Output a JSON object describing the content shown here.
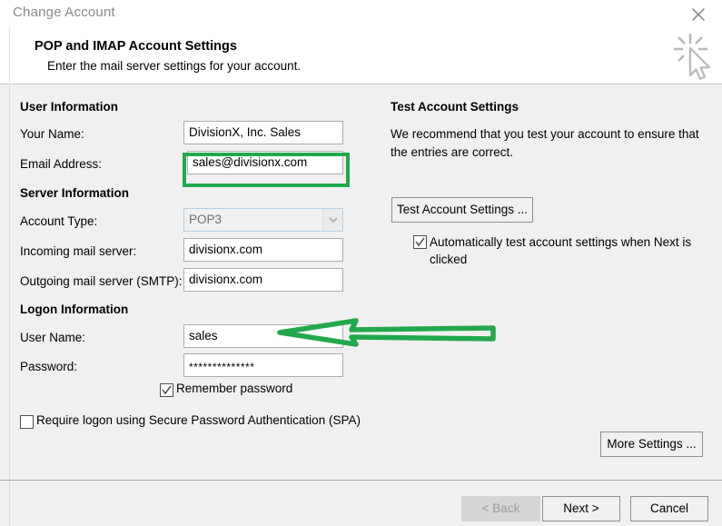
{
  "window": {
    "title": "Change Account",
    "close_icon": "close-icon"
  },
  "header": {
    "title": "POP and IMAP Account Settings",
    "subtitle": "Enter the mail server settings for your account.",
    "graphic_icon": "cursor-click-sparkle-icon"
  },
  "user_information": {
    "group_label": "User Information",
    "fields": [
      {
        "label": "Your Name:",
        "value": "DivisionX, Inc. Sales"
      },
      {
        "label": "Email Address:",
        "value": "sales@divisionx.com"
      }
    ]
  },
  "server_information": {
    "group_label": "Server Information",
    "account_type": {
      "label": "Account Type:",
      "value": "POP3",
      "disabled": true,
      "arrow_icon": "chevron-down-icon"
    },
    "fields": [
      {
        "label": "Incoming mail server:",
        "value": "divisionx.com"
      },
      {
        "label": "Outgoing mail server (SMTP):",
        "value": "divisionx.com"
      }
    ]
  },
  "logon_information": {
    "group_label": "Logon Information",
    "fields": [
      {
        "label": "User Name:",
        "value": "sales"
      },
      {
        "label": "Password:",
        "value": "**************"
      }
    ],
    "remember_password": {
      "label": "Remember password",
      "checked": true
    },
    "require_spa": {
      "label": "Require logon using Secure Password Authentication (SPA)",
      "checked": false
    }
  },
  "test_account": {
    "group_label": "Test Account Settings",
    "description": "We recommend that you test your account to ensure that the entries are correct.",
    "test_button": "Test Account Settings ...",
    "auto_test": {
      "label": "Automatically test account settings when Next is clicked",
      "checked": true
    }
  },
  "more_settings_button": "More Settings ...",
  "footer": {
    "back_button": "< Back",
    "next_button": "Next >",
    "cancel_button": "Cancel"
  },
  "colors": {
    "annotation_green": "#22a84a",
    "dialog_background": "#f0f0f0",
    "header_background": "#ffffff",
    "title_text": "#8a8a8a"
  },
  "annotations": {
    "email_highlight": "green-rectangle-around-email-address",
    "username_pointer": "green-arrow-pointing-to-user-name"
  }
}
